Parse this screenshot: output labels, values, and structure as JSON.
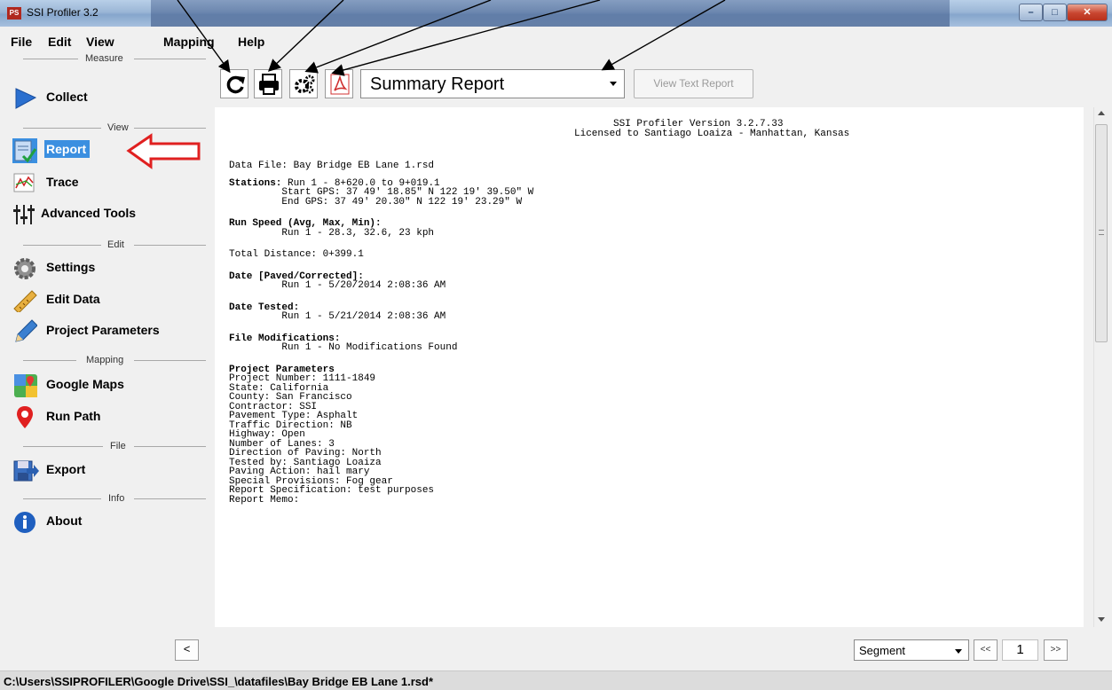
{
  "window": {
    "title": "SSI Profiler 3.2",
    "app_icon_text": "PS",
    "minimize_glyph": "–",
    "maximize_glyph": "□",
    "close_glyph": "✕"
  },
  "menu": {
    "items": [
      "File",
      "Edit",
      "View",
      "Mapping",
      "Help"
    ]
  },
  "sidebar": {
    "sections": [
      {
        "title": "Measure",
        "items": [
          {
            "label": "Collect",
            "icon": "play-icon"
          }
        ]
      },
      {
        "title": "View",
        "items": [
          {
            "label": "Report",
            "icon": "report-icon",
            "active": true
          },
          {
            "label": "Trace",
            "icon": "trace-icon"
          },
          {
            "label": "Advanced Tools",
            "icon": "advanced-tools-icon"
          }
        ]
      },
      {
        "title": "Edit",
        "items": [
          {
            "label": "Settings",
            "icon": "gear-icon"
          },
          {
            "label": "Edit Data",
            "icon": "ruler-icon"
          },
          {
            "label": "Project Parameters",
            "icon": "pencil-icon"
          }
        ]
      },
      {
        "title": "Mapping",
        "items": [
          {
            "label": "Google Maps",
            "icon": "google-maps-icon"
          },
          {
            "label": "Run Path",
            "icon": "map-pin-icon"
          }
        ]
      },
      {
        "title": "File",
        "items": [
          {
            "label": "Export",
            "icon": "export-icon"
          }
        ]
      },
      {
        "title": "Info",
        "items": [
          {
            "label": "About",
            "icon": "info-icon"
          }
        ]
      }
    ],
    "collapse_label": "<"
  },
  "toolbar": {
    "buttons": [
      "refresh-icon",
      "print-icon",
      "settings-icon",
      "pdf-icon"
    ],
    "report_select_value": "Summary Report",
    "view_text_report_label": "View Text Report"
  },
  "report": {
    "header_line1": "SSI Profiler Version 3.2.7.33",
    "header_line2": "Licensed to Santiago Loaiza - Manhattan, Kansas",
    "data_file": "Data File: Bay Bridge EB Lane 1.rsd",
    "stations_label": "Stations:",
    "stations_run": " Run 1 - 8+620.0 to 9+019.1",
    "start_gps": "         Start GPS: 37 49' 18.85\" N 122 19' 39.50\" W",
    "end_gps": "         End GPS: 37 49' 20.30\" N 122 19' 23.29\" W",
    "run_speed_label": "Run Speed (Avg, Max, Min):",
    "run_speed_value": "         Run 1 - 28.3, 32.6, 23 kph",
    "total_distance": "Total Distance: 0+399.1",
    "date_paved_label": "Date [Paved/Corrected]:",
    "date_paved_value": "         Run 1 - 5/20/2014 2:08:36 AM",
    "date_tested_label": "Date Tested:",
    "date_tested_value": "         Run 1 - 5/21/2014 2:08:36 AM",
    "file_mod_label": "File Modifications:",
    "file_mod_value": "         Run 1 - No Modifications Found",
    "project_params_label": "Project Parameters",
    "project_params": [
      "Project Number: 1111-1849",
      "State: California",
      "County: San Francisco",
      "Contractor: SSI",
      "Pavement Type: Asphalt",
      "Traffic Direction: NB",
      "Highway: Open",
      "Number of Lanes: 3",
      "Direction of Paving: North",
      "Tested by: Santiago Loaiza",
      "Paving Action: hail mary",
      "Special Provisions: Fog gear",
      "Report Specification: test purposes",
      "Report Memo:"
    ]
  },
  "pager": {
    "segment_value": "Segment",
    "prev_label": "<<",
    "page_value": "1",
    "next_label": ">>"
  },
  "status": {
    "file_path": "C:\\Users\\SSIPROFILER\\Google Drive\\SSI_\\datafiles\\Bay Bridge EB Lane 1.rsd*"
  },
  "colors": {
    "accent": "#3b8fe0",
    "annotation_arrow": "#e02020"
  }
}
